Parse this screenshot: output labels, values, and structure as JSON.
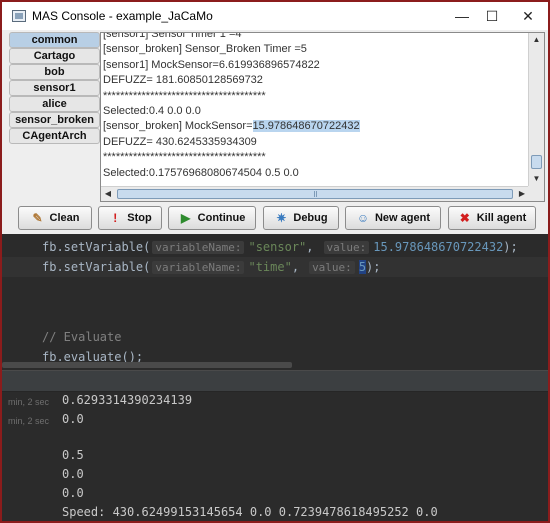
{
  "window": {
    "title": "MAS Console - example_JaCaMo",
    "minimize_glyph": "—",
    "maximize_glyph": "☐",
    "close_glyph": "✕"
  },
  "tabs": [
    "common",
    "Cartago",
    "bob",
    "sensor1",
    "alice",
    "sensor_broken",
    "CAgentArch"
  ],
  "active_tab": "common",
  "console_log": {
    "line0": "[sensor1] Sensor Timer 1 =4",
    "line1": "[sensor_broken] Sensor_Broken Timer  =5",
    "line2": "[sensor1] MockSensor=6.619936896574822",
    "line3": "DEFUZZ= 181.60850128569732",
    "line4": "**************************************",
    "line5": "Selected:0.4  0.0  0.0",
    "line6_prefix": "[sensor_broken] MockSensor=",
    "line6_highlight": "15.978648670722432",
    "line7": "DEFUZZ= 430.6245335934309",
    "line8": "**************************************",
    "line9": "Selected:0.17576968080674504  0.5  0.0"
  },
  "buttons": {
    "clean": "Clean",
    "stop": "Stop",
    "continue": "Continue",
    "debug": "Debug",
    "new_agent": "New agent",
    "kill_agent": "Kill agent"
  },
  "code": {
    "line1": {
      "call": "fb.setVariable(",
      "hint1": "variableName:",
      "arg1": "\"sensor\"",
      "comma1": ",",
      "hint2": "value:",
      "arg2": "15.978648670722432",
      "close": ");"
    },
    "line2": {
      "call": "fb.setVariable(",
      "hint1": "variableName:",
      "arg1": "\"time\"",
      "comma1": ",",
      "hint2": "value:",
      "arg2": "5",
      "close": ");"
    },
    "comment": "// Evaluate",
    "evaluate": "fb.evaluate();"
  },
  "output": {
    "time_label1": "min, 2 sec",
    "time_label2": "min, 2 sec",
    "lines": [
      "0.6293314390234139",
      "0.0",
      "0.5",
      "0.0",
      "0.0",
      "Speed: 430.62499153145654 0.0 0.7239478618495252 0.0"
    ]
  },
  "colors": {
    "frame": "#8b1c1c",
    "active_tab": "#b8cfe5",
    "highlight": "#b9d5ef",
    "editor_bg": "#2b2b2b",
    "string": "#6a8759",
    "number": "#6897bb"
  }
}
